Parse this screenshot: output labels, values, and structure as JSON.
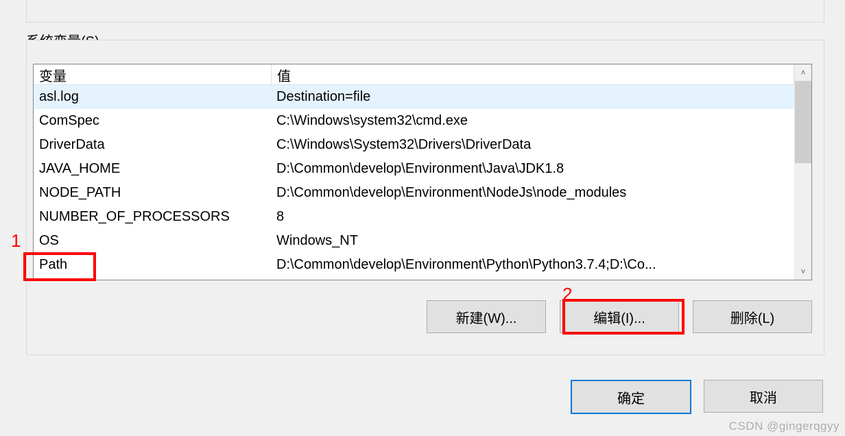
{
  "group": {
    "label": "系统变量(S)"
  },
  "columns": {
    "var": "变量",
    "val": "值"
  },
  "rows": [
    {
      "name": "asl.log",
      "value": "Destination=file",
      "selected": true
    },
    {
      "name": "ComSpec",
      "value": "C:\\Windows\\system32\\cmd.exe",
      "selected": false
    },
    {
      "name": "DriverData",
      "value": "C:\\Windows\\System32\\Drivers\\DriverData",
      "selected": false
    },
    {
      "name": "JAVA_HOME",
      "value": "D:\\Common\\develop\\Environment\\Java\\JDK1.8",
      "selected": false
    },
    {
      "name": "NODE_PATH",
      "value": "D:\\Common\\develop\\Environment\\NodeJs\\node_modules",
      "selected": false
    },
    {
      "name": "NUMBER_OF_PROCESSORS",
      "value": "8",
      "selected": false
    },
    {
      "name": "OS",
      "value": "Windows_NT",
      "selected": false
    },
    {
      "name": "Path",
      "value": "D:\\Common\\develop\\Environment\\Python\\Python3.7.4;D:\\Co...",
      "selected": false
    }
  ],
  "buttons": {
    "new": "新建(W)...",
    "edit": "编辑(I)...",
    "delete": "删除(L)"
  },
  "dialog": {
    "ok": "确定",
    "cancel": "取消"
  },
  "annotations": {
    "one": "1",
    "two": "2"
  },
  "scroll": {
    "up": "˄",
    "down": "˅"
  },
  "watermark": "CSDN @gingerqgyy"
}
